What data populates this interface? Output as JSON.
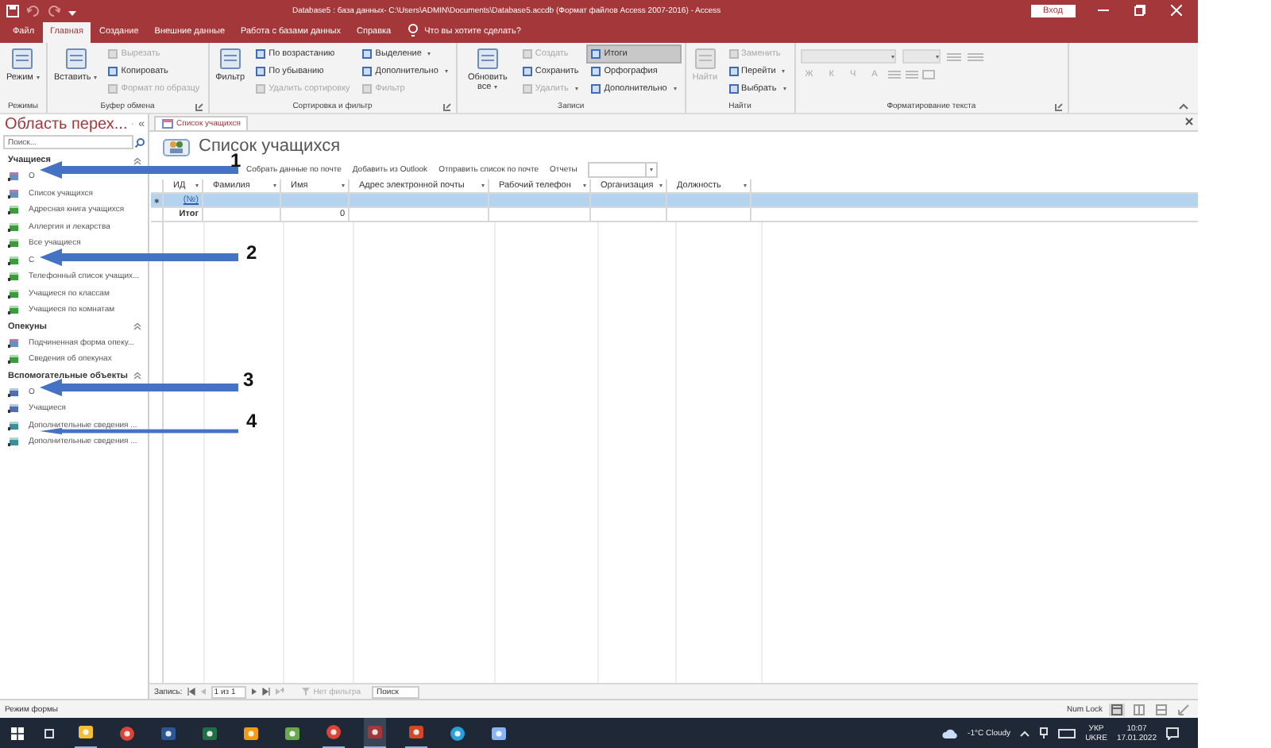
{
  "title_bar": {
    "title": "Database5 : база данных- C:\\Users\\ADMIN\\Documents\\Database5.accdb (Формат файлов Access 2007-2016)  -  Access",
    "sign_in": "Вход"
  },
  "menu_tabs": [
    {
      "label": "Файл",
      "selected": false
    },
    {
      "label": "Главная",
      "selected": true
    },
    {
      "label": "Создание",
      "selected": false
    },
    {
      "label": "Внешние данные",
      "selected": false
    },
    {
      "label": "Работа с базами данных",
      "selected": false
    },
    {
      "label": "Справка",
      "selected": false
    }
  ],
  "tell_me": "Что вы хотите сделать?",
  "ribbon": [
    {
      "label": "Режимы",
      "launcher": false,
      "columns": [
        [
          {
            "label": "Режим",
            "kind": "large",
            "disabled": false,
            "dropdown": true,
            "on": false
          }
        ]
      ]
    },
    {
      "label": "Буфер обмена",
      "launcher": true,
      "columns": [
        [
          {
            "label": "Вставить",
            "kind": "large",
            "disabled": false,
            "dropdown": true,
            "on": false
          }
        ],
        [
          {
            "label": "Вырезать",
            "kind": "small",
            "disabled": true,
            "dropdown": false,
            "on": false
          },
          {
            "label": "Копировать",
            "kind": "small",
            "disabled": false,
            "dropdown": false,
            "on": false
          },
          {
            "label": "Формат по образцу",
            "kind": "small",
            "disabled": true,
            "dropdown": false,
            "on": false
          }
        ]
      ]
    },
    {
      "label": "Сортировка и фильтр",
      "launcher": true,
      "columns": [
        [
          {
            "label": "Фильтр",
            "kind": "large",
            "disabled": false,
            "dropdown": false,
            "on": false
          }
        ],
        [
          {
            "label": "По возрастанию",
            "kind": "small",
            "disabled": false,
            "dropdown": false,
            "on": false
          },
          {
            "label": "По убыванию",
            "kind": "small",
            "disabled": false,
            "dropdown": false,
            "on": false
          },
          {
            "label": "Удалить сортировку",
            "kind": "small",
            "disabled": true,
            "dropdown": false,
            "on": false
          }
        ],
        [
          {
            "label": "Выделение",
            "kind": "small",
            "disabled": false,
            "dropdown": true,
            "on": false
          },
          {
            "label": "Дополнительно",
            "kind": "small",
            "disabled": false,
            "dropdown": true,
            "on": false
          },
          {
            "label": "Фильтр",
            "kind": "small",
            "disabled": true,
            "dropdown": false,
            "on": false
          }
        ]
      ]
    },
    {
      "label": "Записи",
      "launcher": false,
      "columns": [
        [
          {
            "label": "Обновить все",
            "kind": "large",
            "disabled": false,
            "dropdown": true,
            "on": false
          }
        ],
        [
          {
            "label": "Создать",
            "kind": "small",
            "disabled": true,
            "dropdown": false,
            "on": false
          },
          {
            "label": "Сохранить",
            "kind": "small",
            "disabled": false,
            "dropdown": false,
            "on": false
          },
          {
            "label": "Удалить",
            "kind": "small",
            "disabled": true,
            "dropdown": true,
            "on": false
          }
        ],
        [
          {
            "label": "Итоги",
            "kind": "small",
            "disabled": false,
            "dropdown": false,
            "on": true
          },
          {
            "label": "Орфография",
            "kind": "small",
            "disabled": false,
            "dropdown": false,
            "on": false
          },
          {
            "label": "Дополнительно",
            "kind": "small",
            "disabled": false,
            "dropdown": true,
            "on": false
          }
        ]
      ]
    },
    {
      "label": "Найти",
      "launcher": false,
      "columns": [
        [
          {
            "label": "Найти",
            "kind": "large",
            "disabled": true,
            "dropdown": false,
            "on": false
          }
        ],
        [
          {
            "label": "Заменить",
            "kind": "small",
            "disabled": true,
            "dropdown": false,
            "on": false
          },
          {
            "label": "Перейти",
            "kind": "small",
            "disabled": false,
            "dropdown": true,
            "on": false
          },
          {
            "label": "Выбрать",
            "kind": "small",
            "disabled": false,
            "dropdown": true,
            "on": false
          }
        ]
      ]
    }
  ],
  "format_group": {
    "label": "Форматирование текста",
    "launcher": true,
    "disabled": true,
    "glyphs": [
      "Ж",
      "К",
      "Ч",
      "A"
    ]
  },
  "nav_pane": {
    "title": "Область перех...",
    "collapse": "«",
    "search_placeholder": "Поиск...",
    "groups": [
      {
        "label": "Учащиеся",
        "items": [
          {
            "label": "О",
            "kind": "form"
          },
          {
            "label": "Список учащихся",
            "kind": "form"
          },
          {
            "label": "Адресная книга учащихся",
            "kind": "report"
          },
          {
            "label": "Аллергия и лекарства",
            "kind": "report"
          },
          {
            "label": "Все учащиеся",
            "kind": "report"
          },
          {
            "label": "С",
            "kind": "report"
          },
          {
            "label": "Телефонный список учащих...",
            "kind": "report"
          },
          {
            "label": "Учащиеся по классам",
            "kind": "report"
          },
          {
            "label": "Учащиеся по комнатам",
            "kind": "report"
          }
        ]
      },
      {
        "label": "Опекуны",
        "items": [
          {
            "label": "Подчиненная форма опеку...",
            "kind": "form"
          },
          {
            "label": "Сведения об опекунах",
            "kind": "report"
          }
        ]
      },
      {
        "label": "Вспомогательные объекты",
        "items": [
          {
            "label": "О",
            "kind": "table"
          },
          {
            "label": "Учащиеся",
            "kind": "table"
          },
          {
            "label": "Дополнительные сведения ...",
            "kind": "query"
          },
          {
            "label": "Дополнительные сведения ...",
            "kind": "query"
          }
        ]
      }
    ]
  },
  "doc_tab": {
    "label": "Список учащихся",
    "selected": true
  },
  "form": {
    "title": "Список учащихся",
    "actions": [
      "Собрать данные по почте",
      "Добавить из Outlook",
      "Отправить список по почте"
    ],
    "reports_label": "Отчеты",
    "columns": [
      "ИД",
      "Фамилия",
      "Имя",
      "Адрес электронной почты",
      "Рабочий телефон",
      "Организация",
      "Должность"
    ],
    "new_row": {
      "selector": "✱",
      "id": "(№)",
      "selected": true
    },
    "total_row": {
      "label": "Итог",
      "name_value": "0"
    }
  },
  "record_nav": {
    "label": "Запись:",
    "position": "1 из 1",
    "filter": "Нет фильтра",
    "search": "Поиск"
  },
  "status_bar": {
    "mode": "Режим формы",
    "num_lock": "Num Lock"
  },
  "annotations": [
    {
      "label": "1"
    },
    {
      "label": "2"
    },
    {
      "label": "3"
    },
    {
      "label": "4"
    }
  ],
  "taskbar": {
    "apps": [
      {
        "kind": "explorer",
        "running": true
      },
      {
        "kind": "chrome",
        "running": false
      },
      {
        "kind": "word",
        "running": false
      },
      {
        "kind": "excel",
        "running": false
      },
      {
        "kind": "notes",
        "running": false
      },
      {
        "kind": "tool",
        "running": false
      },
      {
        "kind": "chrome",
        "running": true
      },
      {
        "kind": "access",
        "running": true
      },
      {
        "kind": "powerpoint",
        "running": true
      },
      {
        "kind": "edge",
        "running": false
      },
      {
        "kind": "paint",
        "running": false
      }
    ],
    "weather": "-1°C  Cloudy",
    "lang_1": "УКР",
    "lang_2": "UKRE",
    "time": "10:07",
    "date": "17.01.2022"
  }
}
